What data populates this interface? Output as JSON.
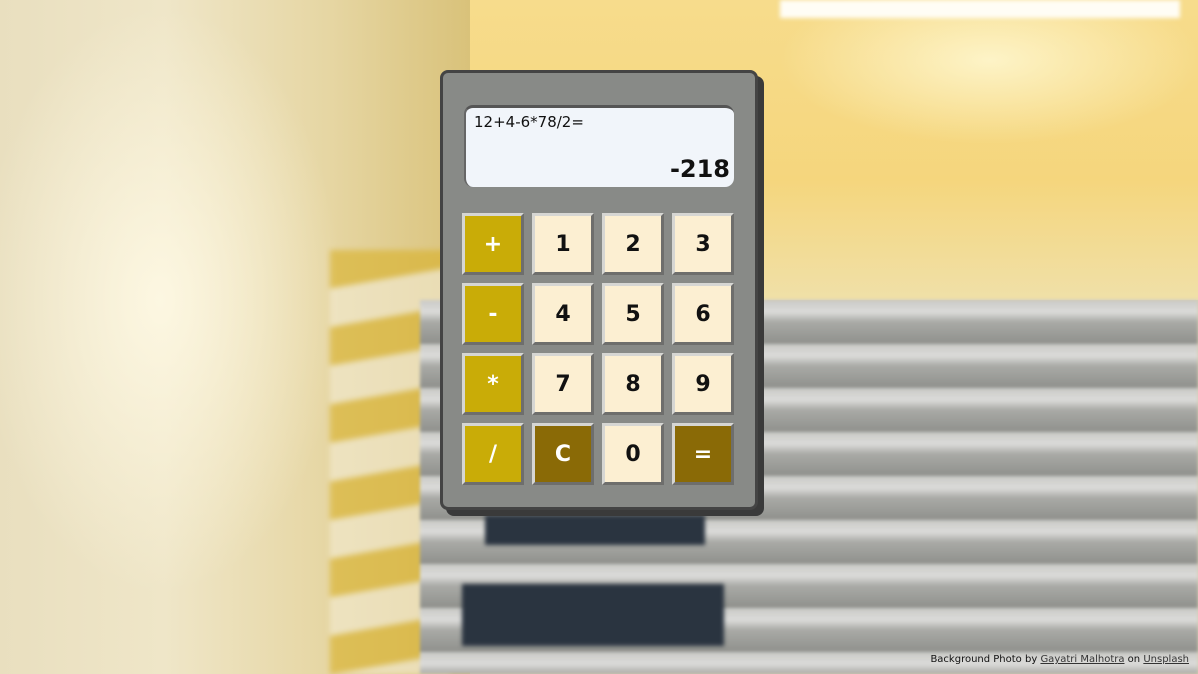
{
  "display": {
    "expression": "12+4-6*78/2=",
    "result": "-218"
  },
  "keys": {
    "add": "+",
    "one": "1",
    "two": "2",
    "three": "3",
    "subtract": "-",
    "four": "4",
    "five": "5",
    "six": "6",
    "multiply": "*",
    "seven": "7",
    "eight": "8",
    "nine": "9",
    "divide": "/",
    "clear": "C",
    "zero": "0",
    "equals": "="
  },
  "credit": {
    "prefix": "Background Photo by ",
    "author": "Gayatri Malhotra",
    "middle": " on ",
    "site": "Unsplash"
  },
  "colors": {
    "operator_key": "#c9ac07",
    "number_key": "#fcefd2",
    "action_key": "#8a6a06",
    "calculator_body": "#888a87",
    "display": "#f1f5fa"
  }
}
